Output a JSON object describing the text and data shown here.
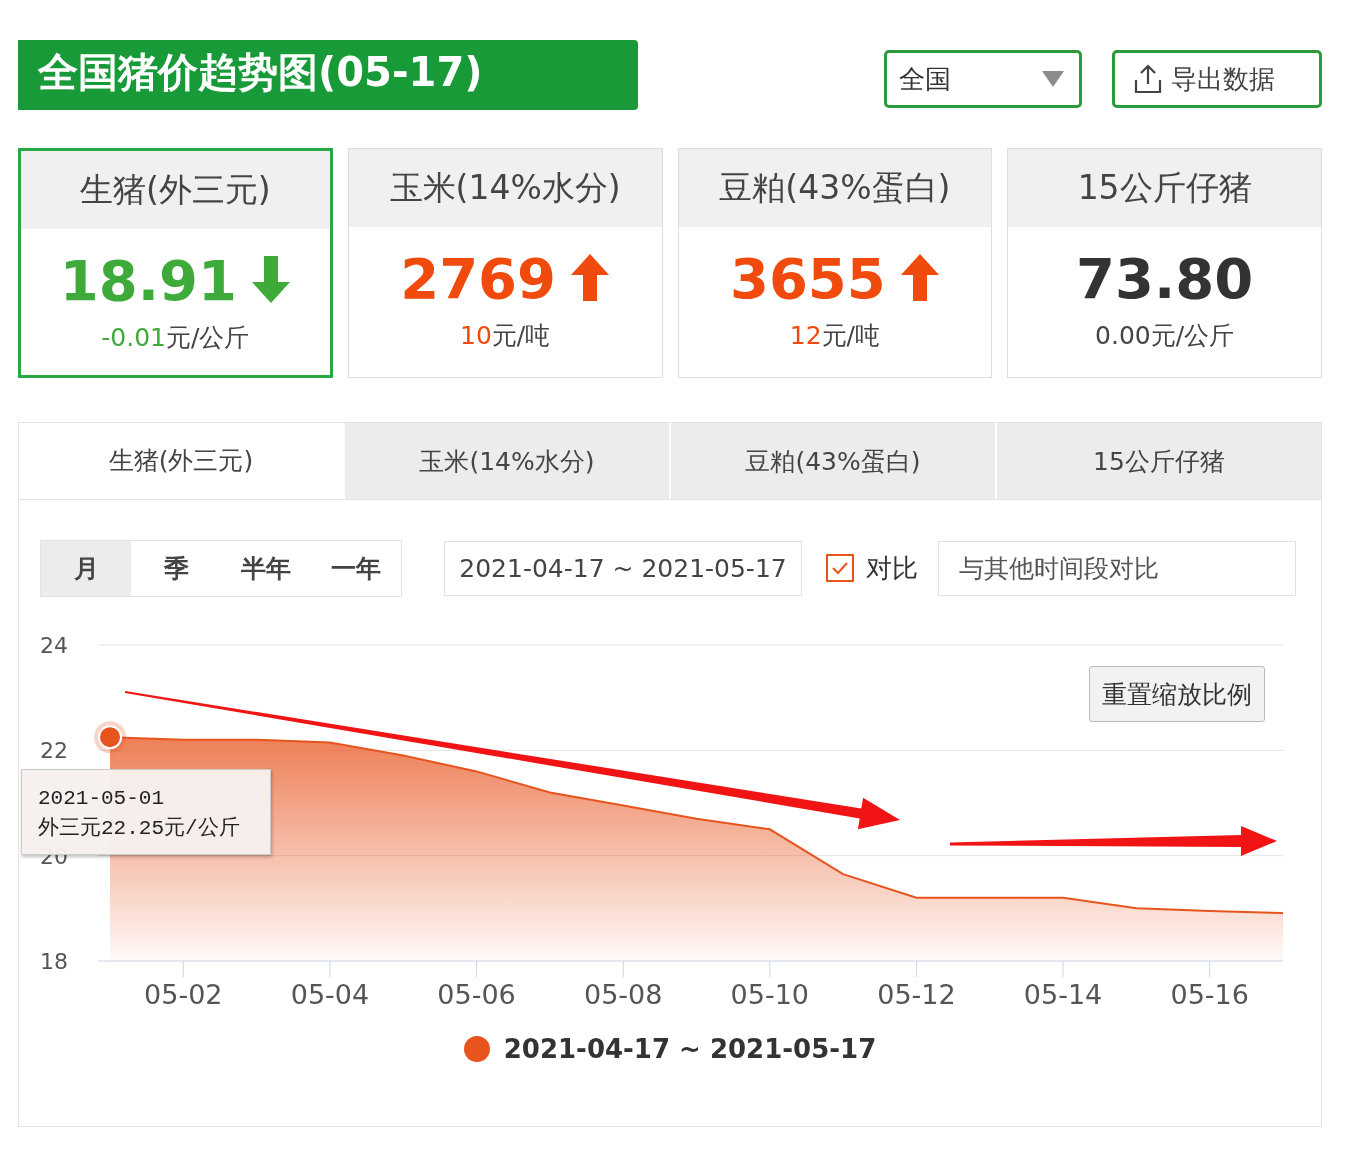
{
  "header": {
    "title": "全国猪价趋势图(05-17)",
    "region_select": {
      "value": "全国"
    },
    "export_button": {
      "label": "导出数据"
    }
  },
  "cards": [
    {
      "title": "生猪(外三元)",
      "value": "18.91",
      "kind": "down",
      "change": "-0.01",
      "unit": "元/公斤",
      "selected": true
    },
    {
      "title": "玉米(14%水分)",
      "value": "2769",
      "kind": "up",
      "change": "10",
      "unit": "元/吨",
      "selected": false
    },
    {
      "title": "豆粕(43%蛋白)",
      "value": "3655",
      "kind": "up",
      "change": "12",
      "unit": "元/吨",
      "selected": false
    },
    {
      "title": "15公斤仔猪",
      "value": "73.80",
      "kind": "flat",
      "change": "0.00",
      "unit": "元/公斤",
      "selected": false
    }
  ],
  "tabs": [
    {
      "label": "生猪(外三元)",
      "selected": true
    },
    {
      "label": "玉米(14%水分)",
      "selected": false
    },
    {
      "label": "豆粕(43%蛋白)",
      "selected": false
    },
    {
      "label": "15公斤仔猪",
      "selected": false
    }
  ],
  "periods": [
    {
      "label": "月",
      "selected": true
    },
    {
      "label": "季",
      "selected": false
    },
    {
      "label": "半年",
      "selected": false
    },
    {
      "label": "一年",
      "selected": false
    }
  ],
  "date_range": "2021-04-17 ~ 2021-05-17",
  "compare": {
    "label": "对比",
    "checked": true
  },
  "compare_field": {
    "placeholder": "与其他时间段对比"
  },
  "reset_zoom_button": "重置缩放比例",
  "tooltip": {
    "date": "2021-05-01",
    "text": "外三元22.25元/公斤"
  },
  "chart_data": {
    "type": "area",
    "categories": [
      null,
      "05-02",
      null,
      "05-04",
      null,
      "05-06",
      null,
      "05-08",
      null,
      "05-10",
      null,
      "05-12",
      null,
      "05-14",
      null,
      "05-16",
      null
    ],
    "series": [
      {
        "name": "2021-04-17 ~ 2021-05-17",
        "color": "#e8541e",
        "values": [
          22.25,
          22.2,
          22.2,
          22.15,
          21.9,
          21.6,
          21.2,
          20.95,
          20.7,
          20.5,
          19.65,
          19.2,
          19.2,
          19.2,
          19.0,
          18.95,
          18.91
        ]
      }
    ],
    "ylim": [
      18,
      24
    ],
    "yticks": [
      18,
      20,
      22,
      24
    ]
  }
}
